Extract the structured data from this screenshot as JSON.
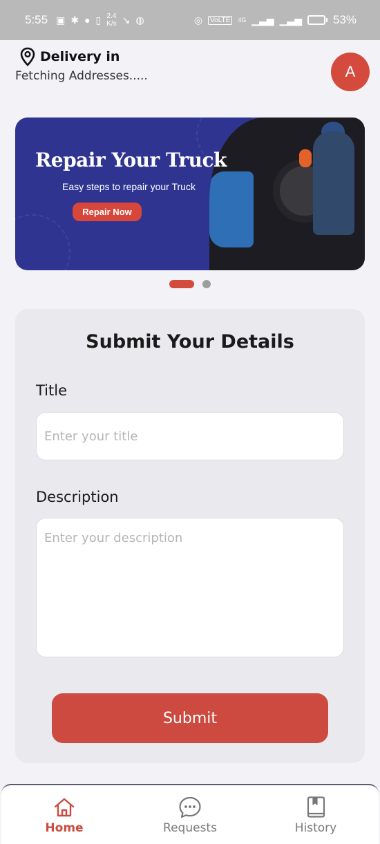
{
  "status_bar": {
    "time": "5:55",
    "net_speed_value": "2.4",
    "net_speed_unit": "K/s",
    "volte": "VoLTE",
    "network_type": "4G",
    "battery": "53%",
    "battery_fraction": 0.53
  },
  "header": {
    "title": "Delivery in",
    "subtitle": "Fetching Addresses.....",
    "avatar_initial": "A"
  },
  "banner": {
    "title": "Repair Your Truck",
    "subtitle": "Easy steps to repair your Truck",
    "button_label": "Repair Now"
  },
  "carousel": {
    "active_index": 0,
    "count": 2
  },
  "form": {
    "title": "Submit Your Details",
    "title_label": "Title",
    "title_placeholder": "Enter your title",
    "title_value": "",
    "description_label": "Description",
    "description_placeholder": "Enter your description",
    "description_value": "",
    "submit_label": "Submit"
  },
  "nav": {
    "items": [
      {
        "label": "Home",
        "icon": "home-icon",
        "active": true
      },
      {
        "label": "Requests",
        "icon": "chat-bubble-icon",
        "active": false
      },
      {
        "label": "History",
        "icon": "book-icon",
        "active": false
      }
    ]
  },
  "colors": {
    "accent": "#cc4a40",
    "banner_bg": "#2f3490",
    "status_bar_bg": "#b9b9b9",
    "page_bg": "#f2f2f7"
  }
}
